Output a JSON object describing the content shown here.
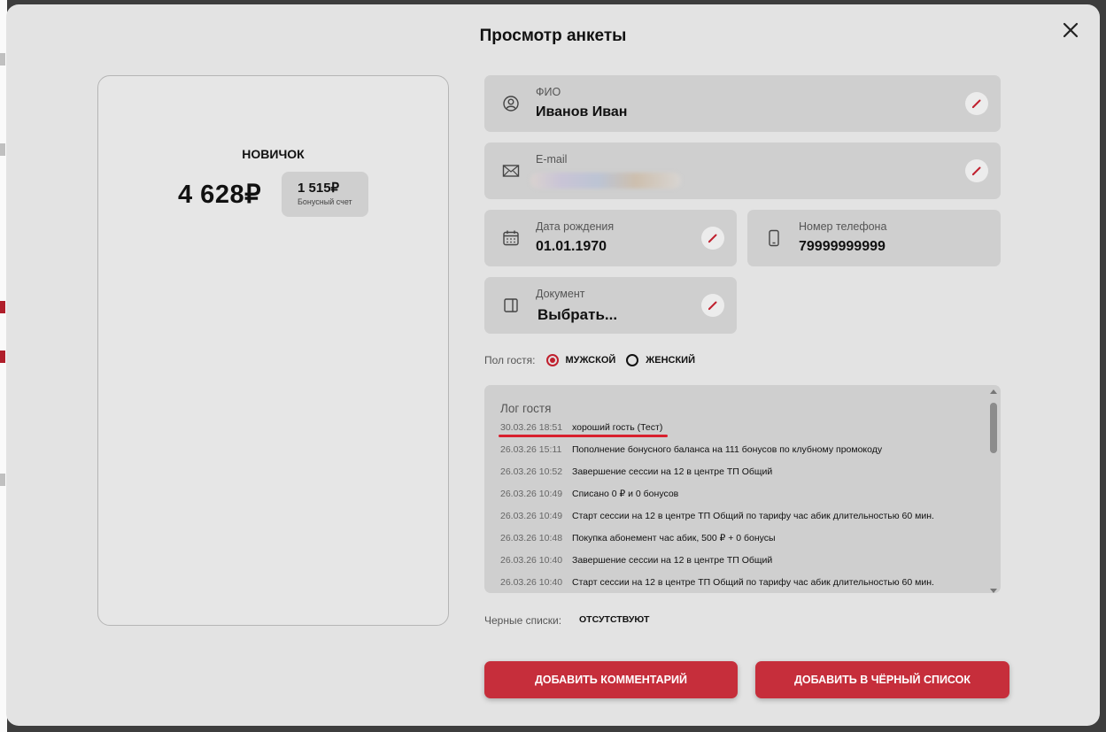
{
  "modal": {
    "title": "Просмотр анкеты"
  },
  "profile_card": {
    "tier": "НОВИЧОК",
    "balance": "4 628₽",
    "bonus_value": "1 515₽",
    "bonus_label": "Бонусный счет"
  },
  "fields": {
    "name": {
      "label": "ФИО",
      "value": "Иванов Иван",
      "icon": "user-icon"
    },
    "email": {
      "label": "E-mail",
      "value": "",
      "icon": "mail-icon"
    },
    "birthdate": {
      "label": "Дата рождения",
      "value": "01.01.1970",
      "icon": "calendar-icon"
    },
    "phone": {
      "label": "Номер телефона",
      "value": "79999999999",
      "icon": "phone-icon"
    },
    "document": {
      "label": "Документ",
      "value": "Выбрать...",
      "icon": "document-icon"
    }
  },
  "gender": {
    "label": "Пол гостя:",
    "options": [
      {
        "label": "МУЖСКОЙ",
        "selected": true
      },
      {
        "label": "ЖЕНСКИЙ",
        "selected": false
      }
    ]
  },
  "log": {
    "title": "Лог гостя",
    "entries": [
      {
        "time": "30.03.26 18:51",
        "text": "хороший гость (Тест)"
      },
      {
        "time": "26.03.26 15:11",
        "text": "Пополнение бонусного баланса на 111 бонусов по клубному промокоду"
      },
      {
        "time": "26.03.26 10:52",
        "text": "Завершение сессии на 12 в центре ТП Общий"
      },
      {
        "time": "26.03.26 10:49",
        "text": "Списано 0 ₽ и 0 бонусов"
      },
      {
        "time": "26.03.26 10:49",
        "text": "Старт сессии на 12 в центре ТП Общий по тарифу час абик длительностью 60 мин."
      },
      {
        "time": "26.03.26 10:48",
        "text": "Покупка абонемент час абик, 500 ₽ + 0 бонусы"
      },
      {
        "time": "26.03.26 10:40",
        "text": "Завершение сессии на 12 в центре ТП Общий"
      },
      {
        "time": "26.03.26 10:40",
        "text": "Старт сессии на 12 в центре ТП Общий по тарифу час абик длительностью 60 мин."
      }
    ]
  },
  "blacklists": {
    "label": "Черные списки:",
    "value": "ОТСУТСТВУЮТ"
  },
  "buttons": {
    "add_comment": "ДОБАВИТЬ КОММЕНТАРИЙ",
    "add_blacklist": "ДОБАВИТЬ В ЧЁРНЫЙ СПИСОК"
  },
  "colors": {
    "accent": "#c62e3b",
    "radio_selected": "#c0202e",
    "highlight_underline": "#d8202e"
  }
}
